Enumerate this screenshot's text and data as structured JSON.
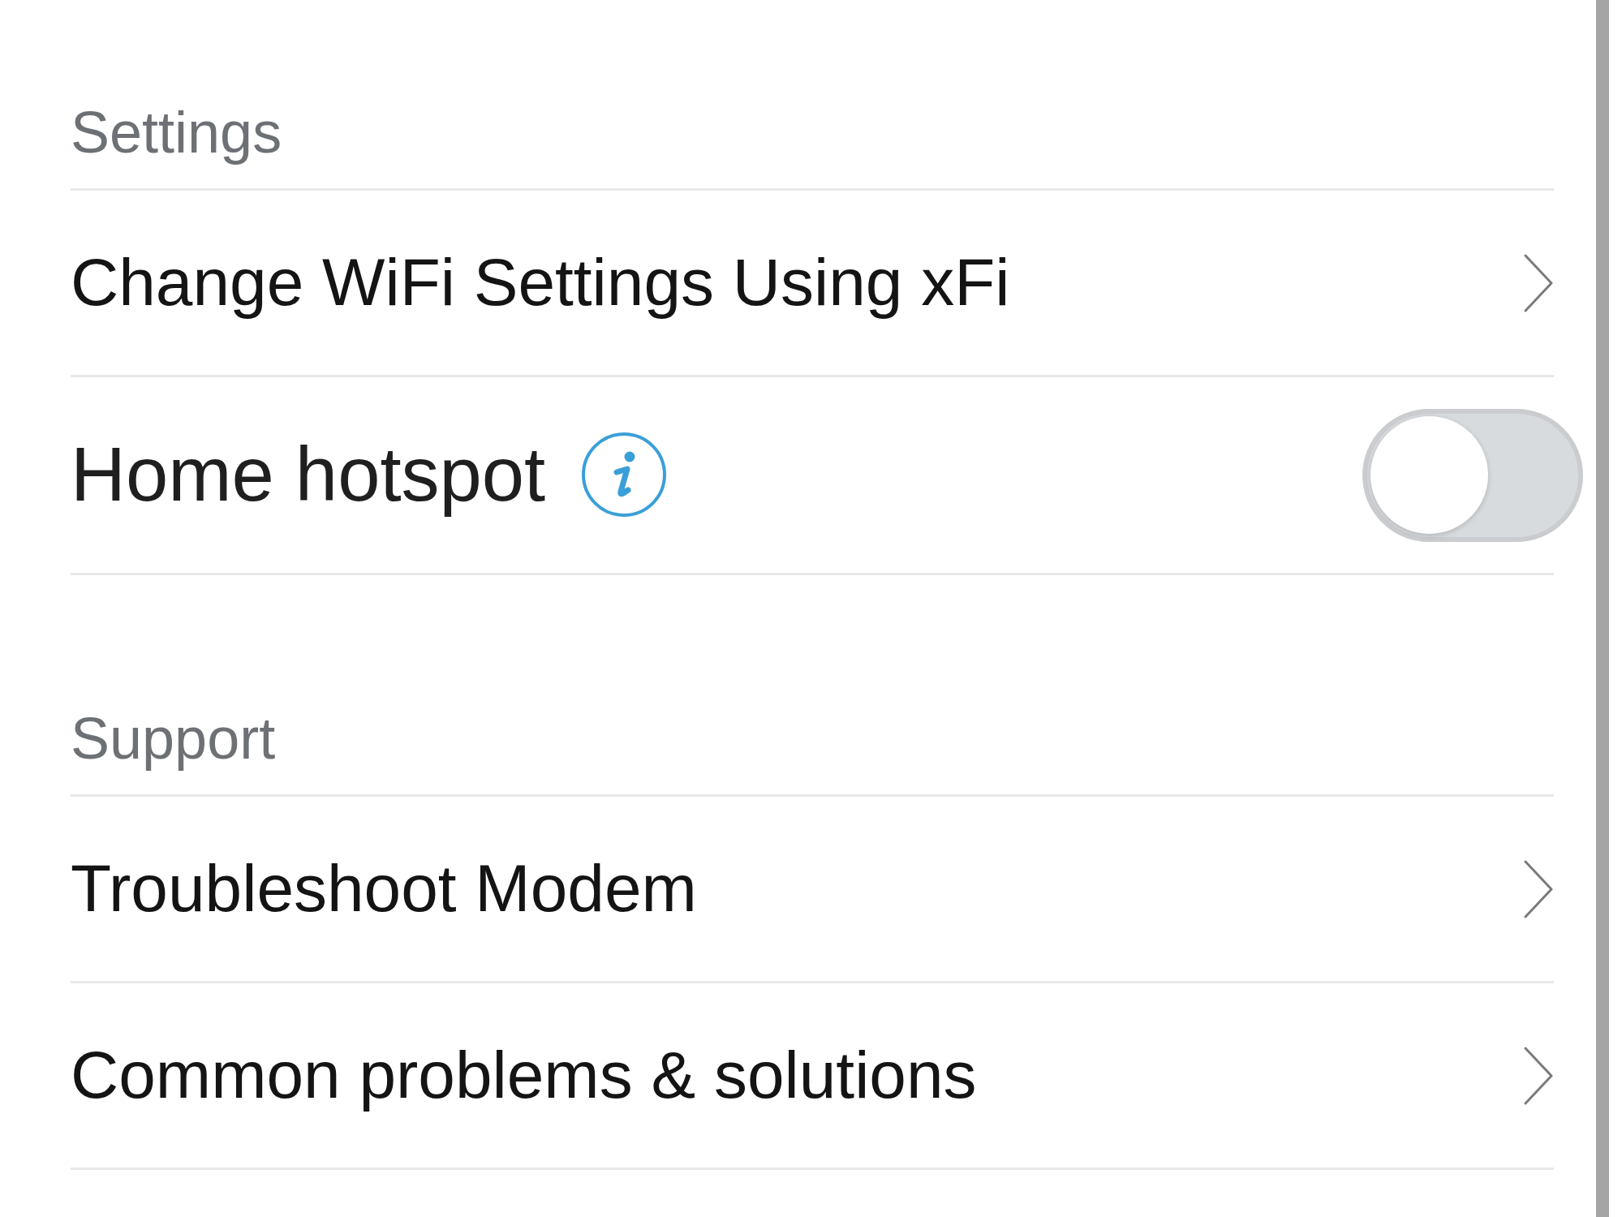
{
  "sections": [
    {
      "title": "Settings",
      "items": [
        {
          "kind": "link",
          "label": "Change WiFi Settings Using xFi"
        },
        {
          "kind": "toggle",
          "label": "Home hotspot",
          "info": true,
          "on": false
        }
      ]
    },
    {
      "title": "Support",
      "items": [
        {
          "kind": "link",
          "label": "Troubleshoot Modem"
        },
        {
          "kind": "link",
          "label": "Common problems & solutions"
        }
      ]
    }
  ]
}
